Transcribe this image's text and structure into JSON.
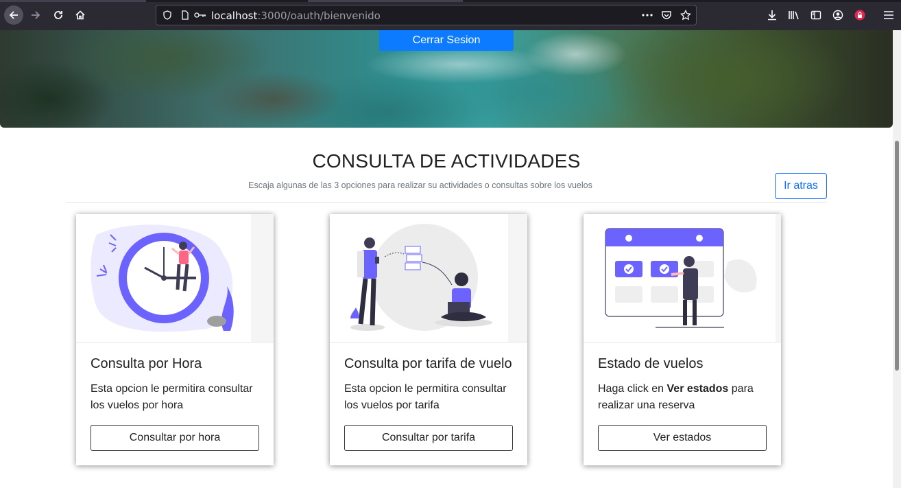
{
  "browser": {
    "url_host": "localhost",
    "url_rest": ":3000/oauth/bienvenido"
  },
  "header": {
    "logout_label": "Cerrar Sesion"
  },
  "section": {
    "title": "CONSULTA DE ACTIVIDADES",
    "subtitle": "Escaja algunas de las 3 opciones para realizar su actividades o consultas sobre los vuelos",
    "back_label": "Ir atras"
  },
  "cards": [
    {
      "title": "Consulta por Hora",
      "text": "Esta opcion le permitira consultar los vuelos por hora",
      "button": "Consultar por hora",
      "illustration": "clock-illustration"
    },
    {
      "title": "Consulta por tarifa de vuelo",
      "text": "Esta opcion le permitira consultar los vuelos por tarifa",
      "button": "Consultar por tarifa",
      "illustration": "money-transfer-illustration"
    },
    {
      "title": "Estado de vuelos",
      "text_before": "Haga click en ",
      "text_bold": "Ver estados",
      "text_after": " para realizar una reserva",
      "button": "Ver estados",
      "illustration": "calendar-illustration"
    }
  ],
  "colors": {
    "accent": "#0d6efd",
    "primary_button": "#0d7bff",
    "illustration": "#6c63ff"
  }
}
